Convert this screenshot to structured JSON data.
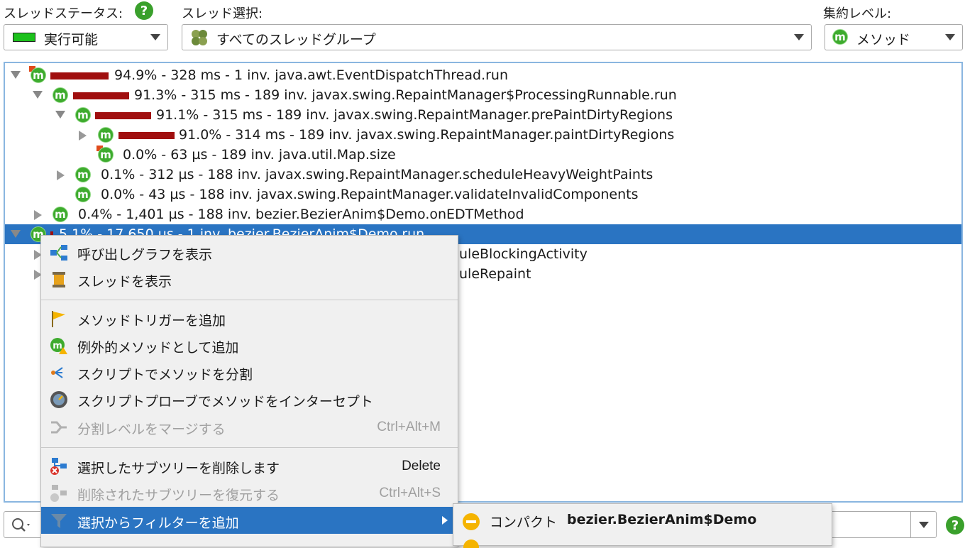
{
  "toolbar": {
    "thread_status_label": "スレッドステータス:",
    "thread_status_value": "実行可能",
    "thread_status_color": "#1cc11c",
    "thread_select_label": "スレッド選択:",
    "thread_select_value": "すべてのスレッドグループ",
    "aggregation_label": "集約レベル:",
    "aggregation_value": "メソッド",
    "help_glyph": "?"
  },
  "tree": {
    "rows": [
      {
        "text": "94.9% - 328 ms - 1 inv. java.awt.EventDispatchThread.run",
        "percent": 94.9,
        "state": "open"
      },
      {
        "text": "91.3% - 315 ms - 189 inv. javax.swing.RepaintManager$ProcessingRunnable.run",
        "percent": 91.3,
        "state": "open"
      },
      {
        "text": "91.1% - 315 ms - 189 inv. javax.swing.RepaintManager.prePaintDirtyRegions",
        "percent": 91.1,
        "state": "open"
      },
      {
        "text": "91.0% - 314 ms - 189 inv. javax.swing.RepaintManager.paintDirtyRegions",
        "percent": 91.0,
        "state": "closed"
      },
      {
        "text": "0.0% - 63 µs - 189 inv. java.util.Map.size",
        "percent": 0.0,
        "state": "leaf"
      },
      {
        "text": "0.1% - 312 µs - 188 inv. javax.swing.RepaintManager.scheduleHeavyWeightPaints",
        "percent": 0.1,
        "state": "closed"
      },
      {
        "text": "0.0% - 43 µs - 188 inv. javax.swing.RepaintManager.validateInvalidComponents",
        "percent": 0.0,
        "state": "leaf"
      },
      {
        "text": "0.4% - 1,401 µs - 188 inv. bezier.BezierAnim$Demo.onEDTMethod",
        "percent": 0.4,
        "state": "closed"
      },
      {
        "text": "5.1% - 17,650 µs - 1 inv. bezier.BezierAnim$Demo.run",
        "percent": 5.1,
        "state": "open",
        "selected": true
      },
      {
        "text": "uleBlockingActivity",
        "state": "closed"
      },
      {
        "text": "uleRepaint",
        "state": "closed"
      }
    ],
    "m_glyph": "m"
  },
  "context_menu": {
    "items": [
      {
        "label": "呼び出しグラフを表示",
        "icon": "call-graph-icon"
      },
      {
        "label": "スレッドを表示",
        "icon": "thread-spool-icon"
      },
      {
        "label": "メソッドトリガーを追加",
        "icon": "trigger-flag-icon"
      },
      {
        "label": "例外的メソッドとして追加",
        "icon": "exceptional-method-icon"
      },
      {
        "label": "スクリプトでメソッドを分割",
        "icon": "split-method-icon"
      },
      {
        "label": "スクリプトプローブでメソッドをインターセプト",
        "icon": "script-probe-icon"
      },
      {
        "label": "分割レベルをマージする",
        "shortcut": "Ctrl+Alt+M",
        "icon": "merge-split-icon",
        "disabled": true
      },
      {
        "label": "選択したサブツリーを削除します",
        "shortcut": "Delete",
        "icon": "delete-subtree-icon"
      },
      {
        "label": "削除されたサブツリーを復元する",
        "shortcut": "Ctrl+Alt+S",
        "icon": "restore-subtree-icon",
        "disabled": true
      },
      {
        "label": "選択からフィルターを追加",
        "icon": "filter-icon",
        "submenu": true,
        "highlighted": true
      }
    ]
  },
  "submenu": {
    "items": [
      {
        "prefix": "コンパクト ",
        "bold": "bezier.BezierAnim$Demo",
        "icon": "compact-filter-icon"
      }
    ]
  }
}
